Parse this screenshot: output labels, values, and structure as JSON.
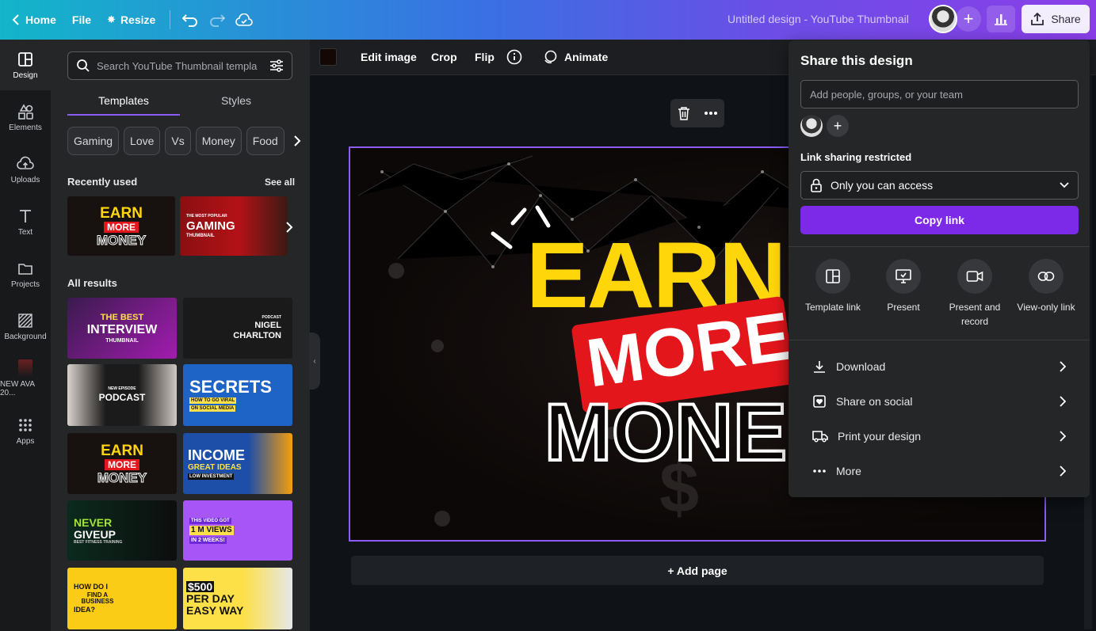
{
  "topbar": {
    "home": "Home",
    "file": "File",
    "resize": "Resize",
    "doc_title": "Untitled design - YouTube Thumbnail",
    "share": "Share"
  },
  "rail": {
    "design": "Design",
    "elements": "Elements",
    "uploads": "Uploads",
    "text": "Text",
    "projects": "Projects",
    "background": "Background",
    "custom": "NEW AVA 20...",
    "apps": "Apps"
  },
  "panel": {
    "search_placeholder": "Search YouTube Thumbnail templa",
    "tab_templates": "Templates",
    "tab_styles": "Styles",
    "chips": [
      "Gaming",
      "Love",
      "Vs",
      "Money",
      "Food"
    ],
    "recently_used": "Recently used",
    "see_all": "See all",
    "all_results": "All results",
    "recent_thumbs": [
      {
        "line1": "EARN",
        "line2": "MORE",
        "line3": "MONEY"
      },
      {
        "line1": "THE MOST POPULAR",
        "line2": "GAMING",
        "line3": "THUMBNAIL"
      }
    ],
    "results": [
      {
        "line1": "THE BEST",
        "line2": "INTERVIEW",
        "line3": "THUMBNAIL"
      },
      {
        "line1": "PODCAST",
        "line2": "NIGEL",
        "line3": "CHARLTON"
      },
      {
        "line1": "NEW EPISODE",
        "line2": "PODCAST",
        "line3": ""
      },
      {
        "line1": "SECRETS",
        "line2": "HOW TO GO VIRAL",
        "line3": "ON SOCIAL MEDIA"
      },
      {
        "line1": "EARN",
        "line2": "MORE",
        "line3": "MONEY"
      },
      {
        "line1": "INCOME",
        "line2": "GREAT IDEAS",
        "line3": "LOW INVESTMENT"
      },
      {
        "line1": "NEVER",
        "line2": "GIVEUP",
        "line3": "BEST FITNESS TRAINING"
      },
      {
        "line1": "THIS VIDEO GOT",
        "line2": "1 M VIEWS",
        "line3": "IN 2 WEEKS!"
      },
      {
        "line1": "HOW DO I",
        "line2": "FIND A BUSINESS",
        "line3": "IDEA?"
      },
      {
        "line1": "$500",
        "line2": "PER DAY",
        "line3": "EASY WAY"
      }
    ]
  },
  "context_bar": {
    "edit_image": "Edit image",
    "crop": "Crop",
    "flip": "Flip",
    "animate": "Animate"
  },
  "design": {
    "line1": "EARN",
    "line2": "MORE",
    "line3": "MONE"
  },
  "add_page": "+ Add page",
  "share_popover": {
    "title": "Share this design",
    "people_placeholder": "Add people, groups, or your team",
    "link_label": "Link sharing restricted",
    "access_value": "Only you can access",
    "copy_link": "Copy link",
    "options": [
      {
        "label": "Template link"
      },
      {
        "label": "Present"
      },
      {
        "label": "Present and record"
      },
      {
        "label": "View-only link"
      }
    ],
    "rows": [
      {
        "label": "Download"
      },
      {
        "label": "Share on social"
      },
      {
        "label": "Print your design"
      },
      {
        "label": "More"
      }
    ]
  },
  "colors": {
    "accent": "#8b5cf6",
    "copy_button": "#7d2ae8",
    "design_yellow": "#ffd60a",
    "design_red": "#e3161b"
  }
}
